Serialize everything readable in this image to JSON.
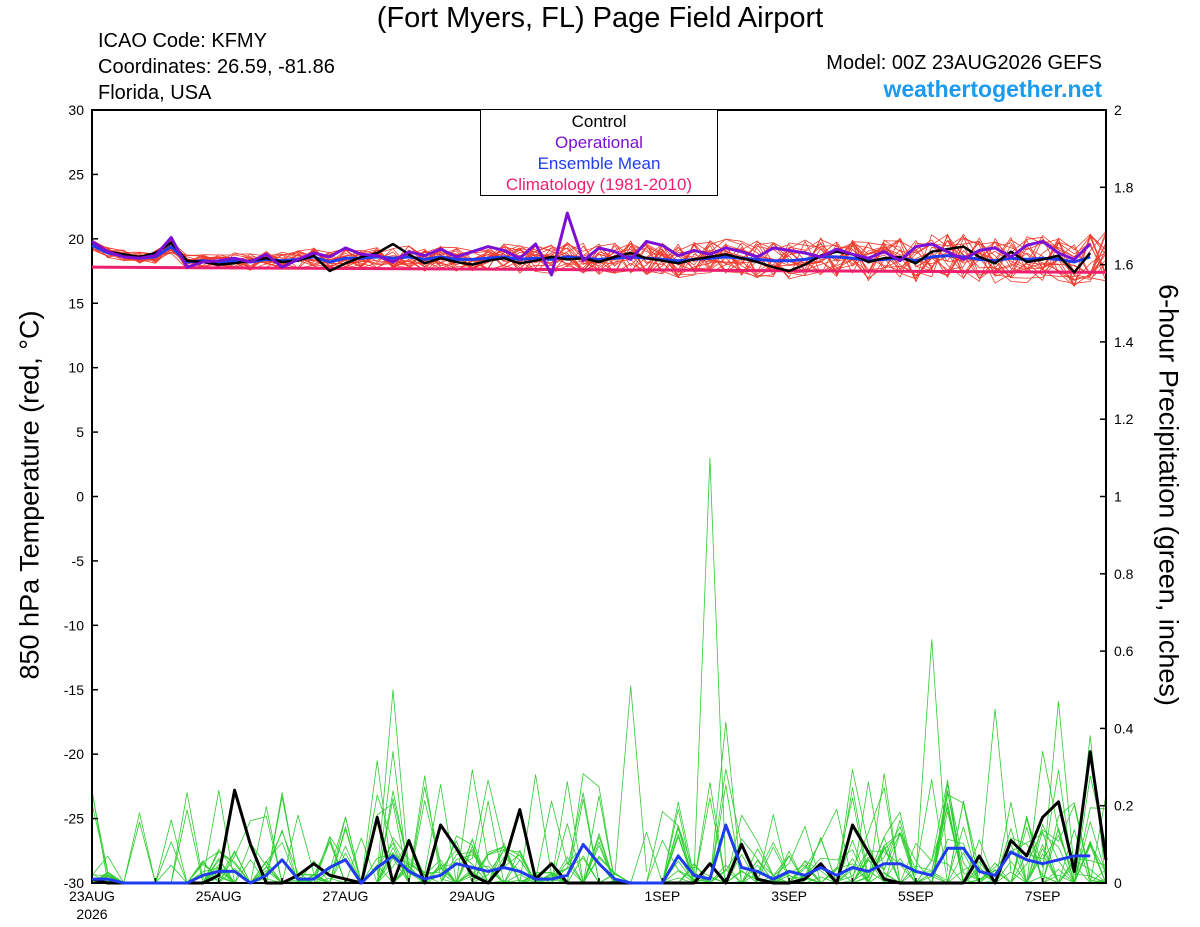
{
  "header": {
    "title": "(Fort Myers, FL) Page Field Airport",
    "icao": "ICAO Code: KFMY",
    "coordinates": "Coordinates: 26.59, -81.86",
    "region": "Florida, USA",
    "model": "Model: 00Z 23AUG2026 GEFS",
    "site": "weathertogether.net"
  },
  "legend": {
    "control": "Control",
    "operational": "Operational",
    "ensemble_mean": "Ensemble Mean",
    "climatology": "Climatology (1981-2010)"
  },
  "colors": {
    "members_temp": "#ef3b2c",
    "members_precip": "#2ecc2e",
    "control": "#000000",
    "operational": "#7b0fd6",
    "ensemble_mean": "#1f3cf0",
    "climatology": "#ef1f6f"
  },
  "chart_data": {
    "type": "line",
    "ylabel_left": "850 hPa Temperature (red, °C)",
    "ylabel_right": "6-hour Precipitation (green, inches)",
    "ylim_left": [
      -30,
      30
    ],
    "ylim_right": [
      0,
      2
    ],
    "y_ticks_left": [
      "30",
      "25",
      "20",
      "15",
      "10",
      "5",
      "0",
      "-5",
      "-10",
      "-15",
      "-20",
      "-25",
      "-30"
    ],
    "y_ticks_right": [
      "2",
      "1.8",
      "1.6",
      "1.4",
      "1.2",
      "1",
      "0.8",
      "0.6",
      "0.4",
      "0.2",
      "0"
    ],
    "x_ticks": [
      {
        "step": 0,
        "label": "23AUG",
        "sub": "2026"
      },
      {
        "step": 8,
        "label": "25AUG"
      },
      {
        "step": 16,
        "label": "27AUG"
      },
      {
        "step": 24,
        "label": "29AUG"
      },
      {
        "step": 36,
        "label": "1SEP"
      },
      {
        "step": 44,
        "label": "3SEP"
      },
      {
        "step": 52,
        "label": "5SEP"
      },
      {
        "step": 60,
        "label": "7SEP"
      }
    ],
    "n_steps": 64,
    "step_hours": 6,
    "climatology_temp": {
      "start": 17.8,
      "end": 17.4
    },
    "control_temp": [
      19.8,
      19.0,
      18.8,
      18.6,
      18.9,
      19.7,
      18.3,
      18.2,
      18.0,
      18.1,
      18.3,
      18.5,
      18.2,
      18.3,
      18.7,
      17.5,
      18.1,
      18.6,
      18.9,
      19.6,
      18.8,
      18.1,
      18.5,
      18.2,
      18.0,
      18.3,
      18.5,
      18.1,
      18.3,
      18.6,
      18.4,
      18.5,
      18.2,
      18.6,
      18.9,
      18.5,
      18.3,
      18.1,
      18.4,
      18.6,
      18.8,
      18.5,
      18.2,
      17.8,
      17.5,
      18.0,
      18.7,
      19.0,
      18.8,
      18.2,
      18.5,
      18.6,
      18.1,
      19.0,
      19.2,
      19.4,
      18.6,
      18.1,
      19.0,
      18.2,
      18.4,
      18.7,
      17.4,
      18.9
    ],
    "operational_temp": [
      19.8,
      19.0,
      18.6,
      18.5,
      18.7,
      20.1,
      17.8,
      18.2,
      18.3,
      18.5,
      18.2,
      18.8,
      17.8,
      18.4,
      18.9,
      18.6,
      19.3,
      18.8,
      18.7,
      18.2,
      19.0,
      18.7,
      19.2,
      18.6,
      19.0,
      19.4,
      19.1,
      18.5,
      19.6,
      17.2,
      22.0,
      18.3,
      19.3,
      19.0,
      18.4,
      19.8,
      19.5,
      18.7,
      19.1,
      18.8,
      19.3,
      19.0,
      18.6,
      19.3,
      19.1,
      18.9,
      18.6,
      19.2,
      18.8,
      18.5,
      19.0,
      18.3,
      19.4,
      19.6,
      19.0,
      18.4,
      19.1,
      19.3,
      18.6,
      19.5,
      19.8,
      18.9,
      18.4,
      19.6
    ],
    "ensemble_mean_temp": [
      19.5,
      18.9,
      18.7,
      18.5,
      18.6,
      19.4,
      18.2,
      18.3,
      18.2,
      18.3,
      18.2,
      18.4,
      18.3,
      18.4,
      18.6,
      18.2,
      18.5,
      18.5,
      18.6,
      18.5,
      18.6,
      18.4,
      18.6,
      18.4,
      18.4,
      18.5,
      18.6,
      18.4,
      18.5,
      18.4,
      18.6,
      18.5,
      18.4,
      18.5,
      18.6,
      18.5,
      18.4,
      18.3,
      18.4,
      18.5,
      18.6,
      18.5,
      18.4,
      18.3,
      18.3,
      18.4,
      18.6,
      18.6,
      18.5,
      18.3,
      18.4,
      18.5,
      18.3,
      18.6,
      18.7,
      18.6,
      18.4,
      18.3,
      18.5,
      18.4,
      18.5,
      18.4,
      18.2,
      18.6
    ],
    "control_precip": [
      0.01,
      0.0,
      0.0,
      0.0,
      0.0,
      0.0,
      0.0,
      0.0,
      0.02,
      0.24,
      0.1,
      0.0,
      0.0,
      0.02,
      0.05,
      0.02,
      0.01,
      0.0,
      0.17,
      0.0,
      0.11,
      0.0,
      0.15,
      0.09,
      0.02,
      0.0,
      0.05,
      0.19,
      0.01,
      0.05,
      0.0,
      0.0,
      0.0,
      0.0,
      0.0,
      0.0,
      0.0,
      0.0,
      0.0,
      0.05,
      0.0,
      0.1,
      0.01,
      0.0,
      0.0,
      0.01,
      0.05,
      0.0,
      0.15,
      0.08,
      0.01,
      0.0,
      0.0,
      0.0,
      0.0,
      0.0,
      0.07,
      0.0,
      0.11,
      0.07,
      0.17,
      0.21,
      0.03,
      0.34,
      0.06
    ],
    "ensemble_mean_precip": [
      0.01,
      0.01,
      0.0,
      0.0,
      0.0,
      0.0,
      0.0,
      0.02,
      0.03,
      0.03,
      0.0,
      0.02,
      0.06,
      0.01,
      0.01,
      0.04,
      0.06,
      0.0,
      0.04,
      0.07,
      0.03,
      0.01,
      0.02,
      0.05,
      0.04,
      0.03,
      0.04,
      0.03,
      0.01,
      0.01,
      0.02,
      0.1,
      0.05,
      0.01,
      0.0,
      0.0,
      0.0,
      0.07,
      0.02,
      0.01,
      0.15,
      0.04,
      0.03,
      0.01,
      0.03,
      0.02,
      0.04,
      0.02,
      0.04,
      0.03,
      0.05,
      0.05,
      0.03,
      0.02,
      0.09,
      0.09,
      0.03,
      0.02,
      0.08,
      0.06,
      0.05,
      0.06,
      0.07,
      0.07
    ]
  }
}
